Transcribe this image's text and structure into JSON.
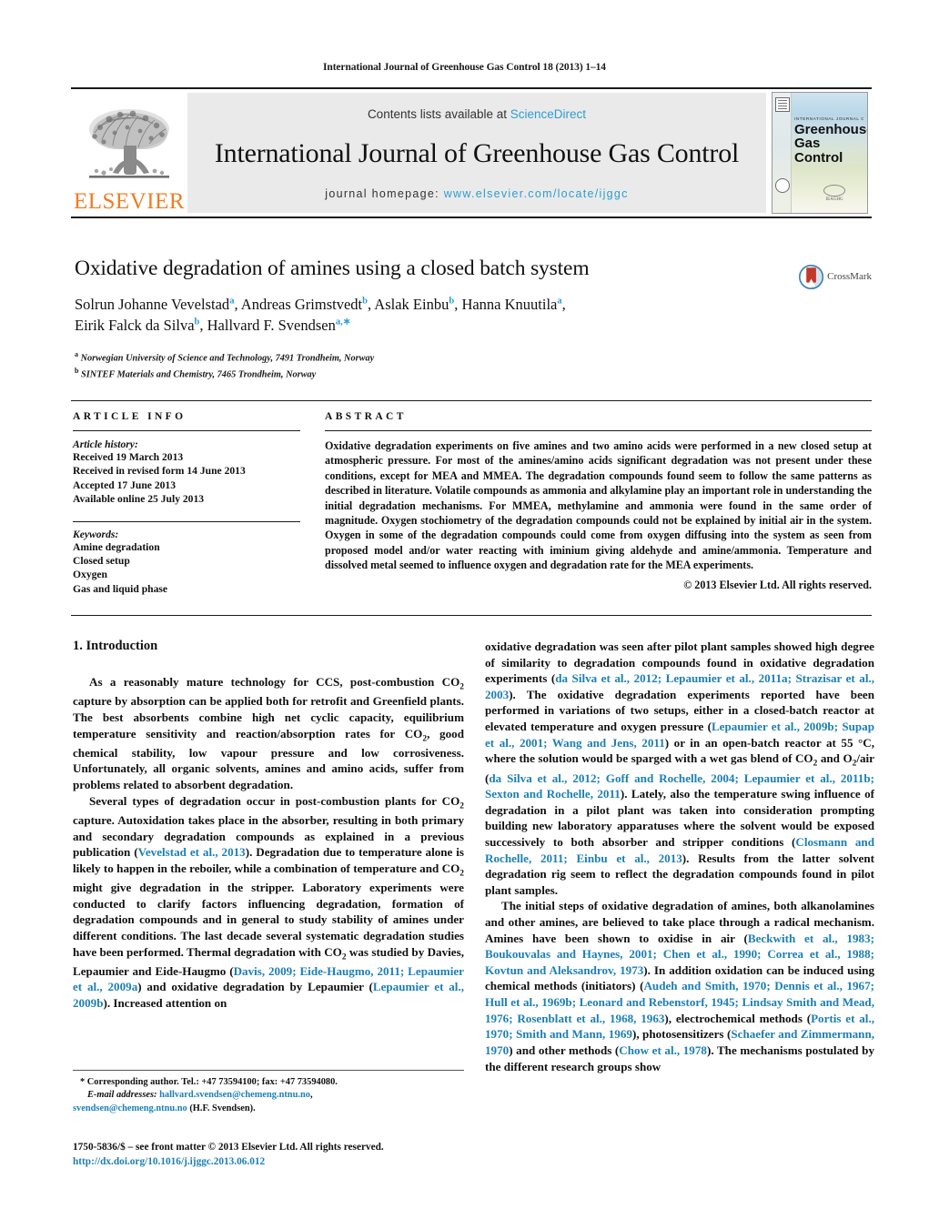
{
  "running_head": "International Journal of Greenhouse Gas Control 18 (2013) 1–14",
  "masthead": {
    "publisher_logo_text": "ELSEVIER",
    "contents_prefix": "Contents lists available at ",
    "contents_link": "ScienceDirect",
    "journal_title": "International Journal of Greenhouse Gas Control",
    "homepage_prefix": "journal homepage:",
    "homepage_url": "www.elsevier.com/locate/ijggc",
    "cover": {
      "supertitle": "INTERNATIONAL JOURNAL OF",
      "title_line1": "Greenhouse",
      "title_line2": "Gas Control",
      "foot_text": "IEAGHG"
    }
  },
  "crossmark": {
    "label": "CrossMark"
  },
  "article": {
    "title": "Oxidative degradation of amines using a closed batch system",
    "authors_line1": "Solrun Johanne Vevelstad",
    "authors_line1_sup1": "a",
    "authors_line1_b": ", Andreas Grimstvedt",
    "authors_line1_sup2": "b",
    "authors_line1_c": ", Aslak Einbu",
    "authors_line1_sup3": "b",
    "authors_line1_d": ", Hanna Knuutila",
    "authors_line1_sup4": "a",
    "authors_line1_e": ",",
    "authors_line2": "Eirik Falck da Silva",
    "authors_line2_sup1": "b",
    "authors_line2_b": ", Hallvard F. Svendsen",
    "authors_line2_sup2": "a,",
    "affiliations": [
      {
        "mark": "a",
        "text": "Norwegian University of Science and Technology, 7491 Trondheim, Norway"
      },
      {
        "mark": "b",
        "text": "SINTEF Materials and Chemistry, 7465 Trondheim, Norway"
      }
    ]
  },
  "article_info": {
    "heading": "ARTICLE INFO",
    "history_label": "Article history:",
    "history": [
      "Received 19 March 2013",
      "Received in revised form 14 June 2013",
      "Accepted 17 June 2013",
      "Available online 25 July 2013"
    ],
    "keywords_label": "Keywords:",
    "keywords": [
      "Amine degradation",
      "Closed setup",
      "Oxygen",
      "Gas and liquid phase"
    ]
  },
  "abstract": {
    "heading": "ABSTRACT",
    "text": "Oxidative degradation experiments on five amines and two amino acids were performed in a new closed setup at atmospheric pressure. For most of the amines/amino acids significant degradation was not present under these conditions, except for MEA and MMEA. The degradation compounds found seem to follow the same patterns as described in literature. Volatile compounds as ammonia and alkylamine play an important role in understanding the initial degradation mechanisms. For MMEA, methylamine and ammonia were found in the same order of magnitude. Oxygen stochiometry of the degradation compounds could not be explained by initial air in the system. Oxygen in some of the degradation compounds could come from oxygen diffusing into the system as seen from proposed model and/or water reacting with iminium giving aldehyde and amine/ammonia. Temperature and dissolved metal seemed to influence oxygen and degradation rate for the MEA experiments.",
    "copyright": "© 2013 Elsevier Ltd. All rights reserved."
  },
  "introduction": {
    "heading": "1. Introduction",
    "left": {
      "p1_a": "As a reasonably mature technology for CCS, post-combustion CO",
      "p1_sub1": "2",
      "p1_b": " capture by absorption can be applied both for retrofit and Greenfield plants. The best absorbents combine high net cyclic capacity, equilibrium temperature sensitivity and reaction/absorption rates for CO",
      "p1_sub2": "2",
      "p1_c": ", good chemical stability, low vapour pressure and low corrosiveness. Unfortunately, all organic solvents, amines and amino acids, suffer from problems related to absorbent degradation.",
      "p2_a": "Several types of degradation occur in post-combustion plants for CO",
      "p2_sub1": "2",
      "p2_b": " capture. Autoxidation takes place in the absorber, resulting in both primary and secondary degradation compounds as explained in a previous publication (",
      "p2_cite1": "Vevelstad et al., 2013",
      "p2_c": "). Degradation due to temperature alone is likely to happen in the reboiler, while a combination of temperature and CO",
      "p2_sub2": "2",
      "p2_d": " might give degradation in the stripper. Laboratory experiments were conducted to clarify factors influencing degradation, formation of degradation compounds and in general to study stability of amines under different conditions. The last decade several systematic degradation studies have been performed. Thermal degradation with CO",
      "p2_sub3": "2",
      "p2_e": " was studied by Davies, Lepaumier and Eide-Haugmo (",
      "p2_cite2": "Davis, 2009; Eide-Haugmo, 2011; Lepaumier et al., 2009a",
      "p2_f": ") and oxidative degradation by Lepaumier (",
      "p2_cite3": "Lepaumier et al., 2009b",
      "p2_g": "). Increased attention on"
    },
    "right": {
      "p1_a": "oxidative degradation was seen after pilot plant samples showed high degree of similarity to degradation compounds found in oxidative degradation experiments (",
      "p1_cite1": "da Silva et al., 2012; Lepaumier et al., 2011a; Strazisar et al., 2003",
      "p1_b": "). The oxidative degradation experiments reported have been performed in variations of two setups, either in a closed-batch reactor at elevated temperature and oxygen pressure (",
      "p1_cite2": "Lepaumier et al., 2009b; Supap et al., 2001; Wang and Jens, 2011",
      "p1_c": ") or in an open-batch reactor at 55 °C, where the solution would be sparged with a wet gas blend of CO",
      "p1_sub1": "2",
      "p1_d": " and O",
      "p1_sub2": "2",
      "p1_e": "/air (",
      "p1_cite3": "da Silva et al., 2012; Goff and Rochelle, 2004; Lepaumier et al., 2011b; Sexton and Rochelle, 2011",
      "p1_f": "). Lately, also the temperature swing influence of degradation in a pilot plant was taken into consideration prompting building new laboratory apparatuses where the solvent would be exposed successively to both absorber and stripper conditions (",
      "p1_cite4": "Closmann and Rochelle, 2011; Einbu et al., 2013",
      "p1_g": "). Results from the latter solvent degradation rig seem to reflect the degradation compounds found in pilot plant samples.",
      "p2_a": "The initial steps of oxidative degradation of amines, both alkanolamines and other amines, are believed to take place through a radical mechanism. Amines have been shown to oxidise in air (",
      "p2_cite1": "Beckwith et al., 1983; Boukouvalas and Haynes, 2001; Chen et al., 1990; Correa et al., 1988; Kovtun and Aleksandrov, 1973",
      "p2_b": "). In addition oxidation can be induced using chemical methods (initiators) (",
      "p2_cite2": "Audeh and Smith, 1970; Dennis et al., 1967; Hull et al., 1969b; Leonard and Rebenstorf, 1945; Lindsay Smith and Mead, 1976; Rosenblatt et al., 1968, 1963",
      "p2_c": "), electrochemical methods (",
      "p2_cite3": "Portis et al., 1970; Smith and Mann, 1969",
      "p2_d": "), photosensitizers (",
      "p2_cite4": "Schaefer and Zimmermann, 1970",
      "p2_e": ") and other methods (",
      "p2_cite5": "Chow et al., 1978",
      "p2_f": "). The mechanisms postulated by the different research groups show"
    }
  },
  "footnote": {
    "star": "*",
    "corresponding": " Corresponding author. Tel.: +47 73594100; fax: +47 73594080.",
    "email_label": "E-mail addresses:",
    "email1": "hallvard.svendsen@chemeng.ntnu.no",
    "email2": "svendsen@chemeng.ntnu.no",
    "email_owner": " (H.F. Svendsen)."
  },
  "front_matter": {
    "issn_line": "1750-5836/$ – see front matter © 2013 Elsevier Ltd. All rights reserved.",
    "doi": "http://dx.doi.org/10.1016/j.ijggc.2013.06.012"
  },
  "colors": {
    "link": "#1c7fb5",
    "sciencedirect": "#2e9dd1",
    "elsevier_orange": "#F47B20",
    "band_gray": "#eaeaea"
  }
}
